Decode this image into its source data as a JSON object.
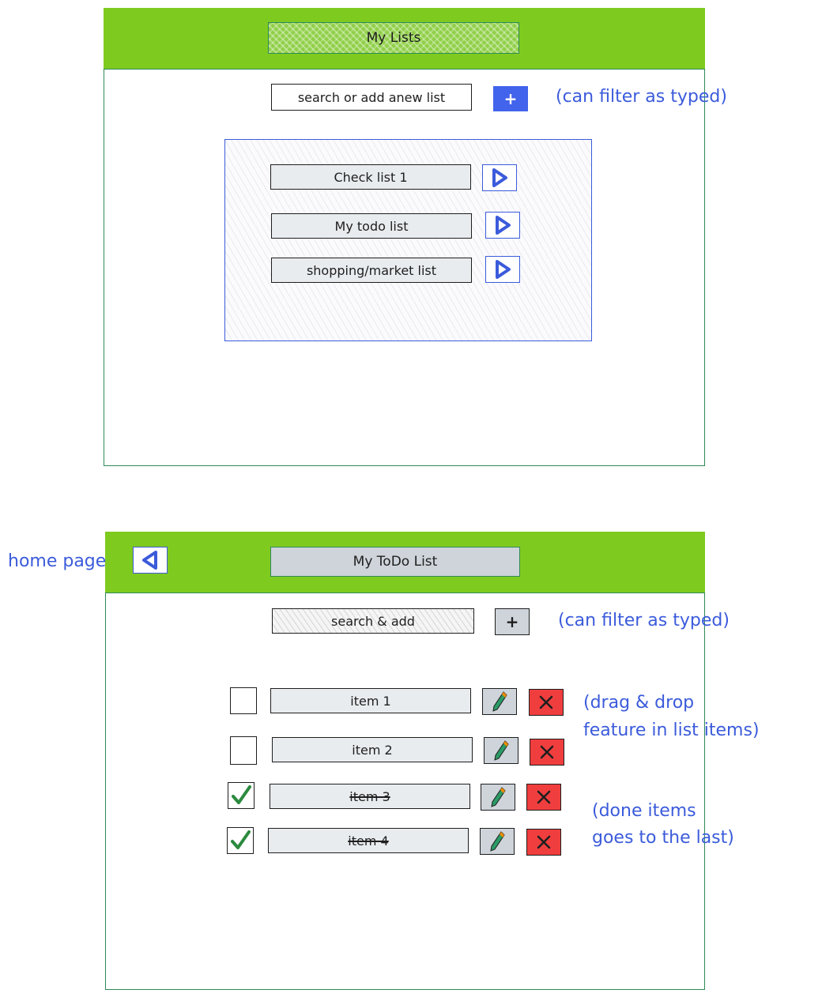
{
  "screen1": {
    "title": "My Lists",
    "search_placeholder": "search or add anew list",
    "add_button": "+",
    "filter_note": "(can filter as typed)",
    "lists": [
      {
        "label": "Check list 1"
      },
      {
        "label": "My todo list"
      },
      {
        "label": "shopping/market list"
      }
    ]
  },
  "screen2": {
    "home_note": "home page",
    "title": "My ToDo List",
    "search_placeholder": "search & add",
    "add_button": "+",
    "filter_note": "(can filter as typed)",
    "items": [
      {
        "label": "item 1",
        "done": false
      },
      {
        "label": "item 2",
        "done": false
      },
      {
        "label": "item 3",
        "done": true
      },
      {
        "label": "item 4",
        "done": true
      }
    ],
    "drag_note_line1": "(drag & drop",
    "drag_note_line2": "feature in list items)",
    "done_note_line1": "(done items",
    "done_note_line2": "goes to the last)"
  },
  "colors": {
    "header_green": "#7fca1f",
    "frame_green": "#2f8a57",
    "annotation_blue": "#3b5bdb",
    "button_blue": "#4263eb",
    "delete_red": "#f03e3e",
    "check_green": "#2b8a3e"
  },
  "icons": {
    "open_list": "play-triangle-icon",
    "back": "back-triangle-icon",
    "edit": "pencil-icon",
    "delete": "x-icon",
    "check": "checkmark-icon"
  }
}
